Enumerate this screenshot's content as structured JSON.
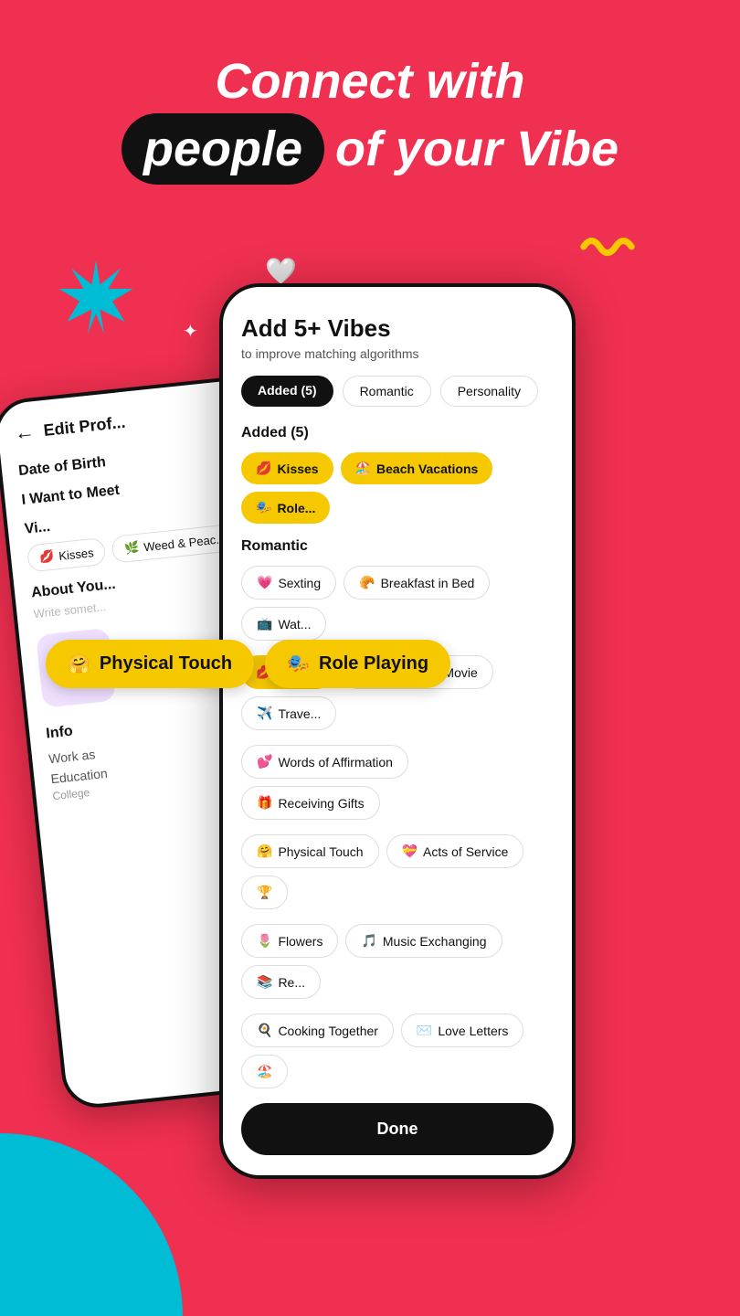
{
  "background_color": "#f03050",
  "header": {
    "line1": "Connect with",
    "line2_bubble": "people",
    "line2_rest": "of your Vibe"
  },
  "back_phone": {
    "title": "Edit Prof...",
    "sections": [
      {
        "label": "Date of Birth"
      },
      {
        "label": "I Want to Meet"
      },
      {
        "label": "Vibes"
      },
      {
        "label": "About You..."
      },
      {
        "label": "Info"
      },
      {
        "label": "Work as"
      },
      {
        "label": "Education"
      }
    ],
    "chips": [
      {
        "emoji": "💋",
        "text": "Kisses"
      },
      {
        "emoji": "🌿",
        "text": "Weed & Peac..."
      }
    ]
  },
  "front_phone": {
    "title": "Add 5+ Vibes",
    "subtitle": "to improve matching algorithms",
    "filter_tabs": [
      {
        "label": "Added (5)",
        "active": true
      },
      {
        "label": "Romantic",
        "active": false
      },
      {
        "label": "Personality",
        "active": false
      }
    ],
    "added_section": {
      "header": "Added (5)",
      "chips": [
        {
          "emoji": "💋",
          "text": "Kisses",
          "selected": true
        },
        {
          "emoji": "🏖️",
          "text": "Beach Vacations",
          "selected": true
        },
        {
          "emoji": "🎭",
          "text": "Role...",
          "selected": true
        }
      ]
    },
    "romantic_section": {
      "header": "Romantic",
      "rows": [
        [
          {
            "emoji": "💗",
            "text": "Sexting",
            "selected": false
          },
          {
            "emoji": "🥐",
            "text": "Breakfast in Bed",
            "selected": false
          },
          {
            "emoji": "📺",
            "text": "Wat...",
            "selected": false
          }
        ],
        [
          {
            "emoji": "💋",
            "text": "Kisses",
            "selected": true
          },
          {
            "emoji": "🎬",
            "text": "Cuddling & Movie",
            "selected": false
          },
          {
            "emoji": "✈️",
            "text": "Trave...",
            "selected": false
          }
        ],
        [
          {
            "emoji": "💕",
            "text": "Words of Affirmation",
            "selected": false
          },
          {
            "emoji": "🎁",
            "text": "Receiving Gifts",
            "selected": false
          }
        ],
        [
          {
            "emoji": "🤗",
            "text": "Physical Touch",
            "selected": false
          },
          {
            "emoji": "💝",
            "text": "Acts of Service",
            "selected": false
          },
          {
            "emoji": "🏆",
            "text": "",
            "selected": false
          }
        ],
        [
          {
            "emoji": "🌷",
            "text": "Flowers",
            "selected": false
          },
          {
            "emoji": "🎵",
            "text": "Music Exchanging",
            "selected": false
          },
          {
            "emoji": "📚",
            "text": "Re...",
            "selected": false
          }
        ],
        [
          {
            "emoji": "🍳",
            "text": "Cooking Together",
            "selected": false
          },
          {
            "emoji": "✉️",
            "text": "Love Letters",
            "selected": false
          },
          {
            "emoji": "🏖️",
            "text": "...",
            "selected": false
          }
        ]
      ]
    },
    "done_button": "Done"
  },
  "floating_chips": [
    {
      "emoji": "🤗",
      "text": "Physical Touch"
    },
    {
      "emoji": "🎭",
      "text": "Role Playing"
    }
  ]
}
